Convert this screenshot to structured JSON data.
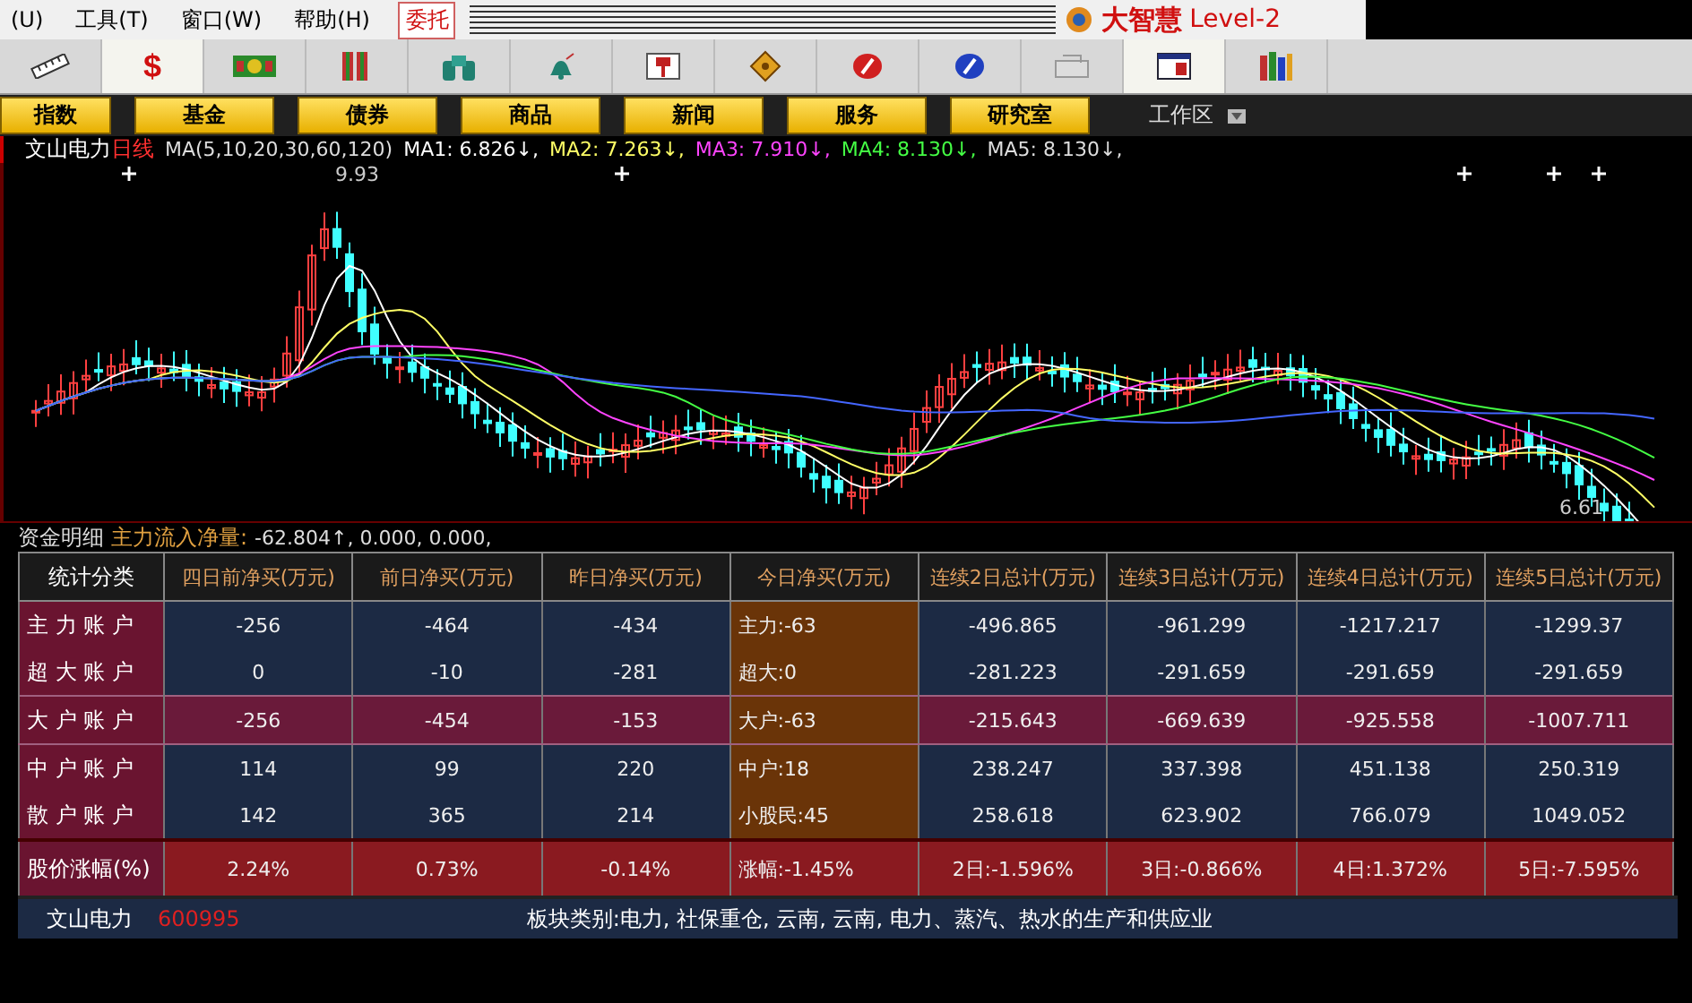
{
  "menu": [
    {
      "label": "(U)"
    },
    {
      "label": "工具(T)"
    },
    {
      "label": "窗口(W)"
    },
    {
      "label": "帮助(H)"
    }
  ],
  "trade_button": "委托",
  "brand": {
    "name": "大智慧",
    "edition": "Level-2"
  },
  "toolbar": [
    {
      "kind": "ruler",
      "selected": false
    },
    {
      "kind": "glyph",
      "glyph": "$",
      "selected": true
    },
    {
      "kind": "money",
      "selected": false
    },
    {
      "kind": "bars",
      "selected": false
    },
    {
      "kind": "binoculars",
      "selected": false
    },
    {
      "kind": "bell",
      "selected": false
    },
    {
      "kind": "flag",
      "selected": false
    },
    {
      "kind": "diamond",
      "selected": false
    },
    {
      "kind": "red-disc",
      "selected": false
    },
    {
      "kind": "blue-disc",
      "selected": false
    },
    {
      "kind": "tray",
      "selected": false
    },
    {
      "kind": "window",
      "selected": true
    },
    {
      "kind": "books",
      "selected": false
    }
  ],
  "nav_buttons": [
    "指数",
    "基金",
    "债券",
    "商品",
    "新闻",
    "服务",
    "研究室"
  ],
  "workspace": "工作区",
  "chart": {
    "stock_name": "文山电力",
    "period": "日线",
    "ma_params": "MA(5,10,20,30,60,120)",
    "ma": [
      {
        "label": "MA1: ",
        "value": "6.826↓,",
        "color": "#ffffff"
      },
      {
        "label": "MA2: ",
        "value": "7.263↓,",
        "color": "#ffff66"
      },
      {
        "label": "MA3: ",
        "value": "7.910↓,",
        "color": "#ff44ff"
      },
      {
        "label": "MA4: ",
        "value": "8.130↓,",
        "color": "#44ff44"
      },
      {
        "label": "MA5: ",
        "value": "8.130↓,",
        "color": "#dddddd"
      }
    ],
    "high_label": "9.93",
    "low_label": "6.61"
  },
  "flow": {
    "title": "资金明细",
    "label": "主力流入净量: ",
    "values": "-62.804↑, 0.000, 0.000,"
  },
  "table": {
    "columns": [
      "统计分类",
      "四日前净买(万元)",
      "前日净买(万元)",
      "昨日净买(万元)",
      "今日净买(万元)",
      "连续2日总计(万元)",
      "连续3日总计(万元)",
      "连续4日总计(万元)",
      "连续5日总计(万元)"
    ],
    "rows": [
      {
        "kind": "account",
        "cells": [
          "主 力 账 户",
          "-256",
          "-464",
          "-434",
          "主力:-63",
          "-496.865",
          "-961.299",
          "-1217.217",
          "-1299.37"
        ]
      },
      {
        "kind": "account",
        "cells": [
          "超 大 账 户",
          "0",
          "-10",
          "-281",
          "超大:0",
          "-281.223",
          "-291.659",
          "-291.659",
          "-291.659"
        ]
      },
      {
        "kind": "highlight",
        "cells": [
          "大 户 账 户",
          "-256",
          "-454",
          "-153",
          "大户:-63",
          "-215.643",
          "-669.639",
          "-925.558",
          "-1007.711"
        ]
      },
      {
        "kind": "account",
        "cells": [
          "中 户 账 户",
          "114",
          "99",
          "220",
          "中户:18",
          "238.247",
          "337.398",
          "451.138",
          "250.319"
        ]
      },
      {
        "kind": "account",
        "cells": [
          "散 户 账 户",
          "142",
          "365",
          "214",
          "小股民:45",
          "258.618",
          "623.902",
          "766.079",
          "1049.052"
        ]
      },
      {
        "kind": "change",
        "cells": [
          "股价涨幅(%)",
          "2.24%",
          "0.73%",
          "-0.14%",
          "涨幅:-1.45%",
          "2日:-1.596%",
          "3日:-0.866%",
          "4日:1.372%",
          "5日:-7.595%"
        ]
      }
    ]
  },
  "footer": {
    "name": "文山电力",
    "code": "600995",
    "sector_label": "板块类别: ",
    "sectors": "电力, 社保重仓, 云南, 云南, 电力、蒸汽、热水的生产和供应业"
  }
}
